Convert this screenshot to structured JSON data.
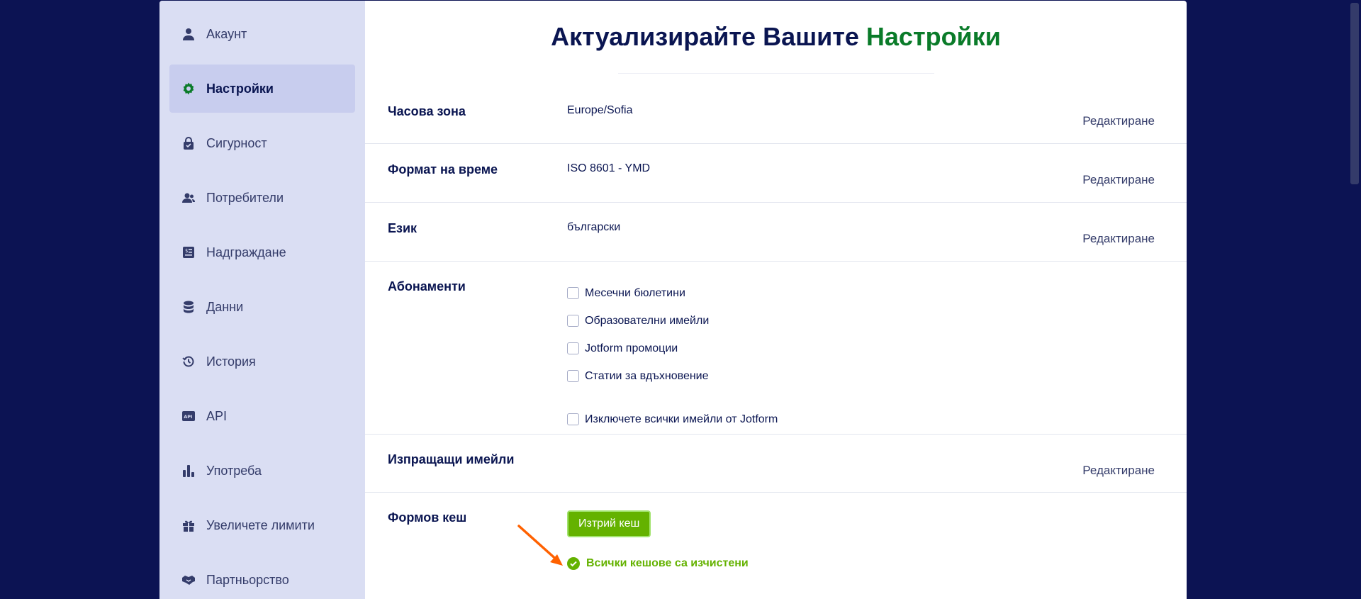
{
  "sidebar": {
    "items": [
      {
        "label": "Акаунт",
        "icon": "user-icon",
        "active": false
      },
      {
        "label": "Настройки",
        "icon": "gear-icon",
        "active": true
      },
      {
        "label": "Сигурност",
        "icon": "lock-icon",
        "active": false
      },
      {
        "label": "Потребители",
        "icon": "users-icon",
        "active": false
      },
      {
        "label": "Надграждане",
        "icon": "invoice-icon",
        "active": false
      },
      {
        "label": "Данни",
        "icon": "database-icon",
        "active": false
      },
      {
        "label": "История",
        "icon": "history-icon",
        "active": false
      },
      {
        "label": "API",
        "icon": "api-icon",
        "active": false
      },
      {
        "label": "Употреба",
        "icon": "bar-chart-icon",
        "active": false
      },
      {
        "label": "Увеличете лимити",
        "icon": "gift-icon",
        "active": false
      },
      {
        "label": "Партньорство",
        "icon": "handshake-icon",
        "active": false
      }
    ]
  },
  "page": {
    "title_prefix": "Актуализирайте Вашите",
    "title_accent": "Настройки"
  },
  "settings": {
    "timezone": {
      "label": "Часова зона",
      "value": "Europe/Sofia",
      "edit": "Редактиране"
    },
    "time_format": {
      "label": "Формат на време",
      "value": "ISO 8601 - YMD",
      "edit": "Редактиране"
    },
    "language": {
      "label": "Език",
      "value": "български",
      "edit": "Редактиране"
    },
    "subscriptions": {
      "label": "Абонаменти",
      "options": [
        "Месечни бюлетини",
        "Образователни имейли",
        "Jotform промоции",
        "Статии за вдъхновение"
      ],
      "exclude_all": "Изключете всички имейли от Jotform"
    },
    "sender_emails": {
      "label": "Изпращащи имейли",
      "edit": "Редактиране"
    },
    "form_cache": {
      "label": "Формов кеш",
      "button": "Изтрий кеш",
      "status": "Всички кешове са изчистени"
    }
  },
  "colors": {
    "background": "#0c1353",
    "sidebar": "#dadef3",
    "accent_green": "#0a7b29",
    "button_green": "#64b200",
    "arrow": "#ff6100"
  }
}
